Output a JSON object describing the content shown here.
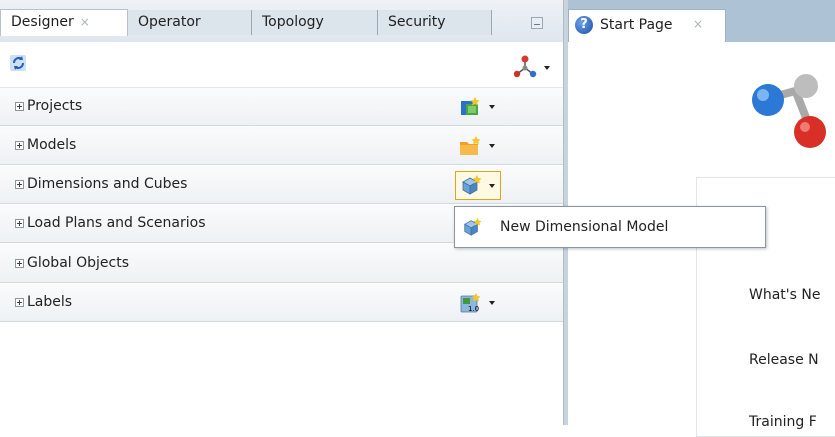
{
  "left_tabs": {
    "designer": "Designer",
    "operator": "Operator",
    "topology": "Topology",
    "security": "Security",
    "close_glyph": "×"
  },
  "navigator_rows": [
    {
      "label": "Projects",
      "icon": "new-project-icon"
    },
    {
      "label": "Models",
      "icon": "new-model-folder-icon"
    },
    {
      "label": "Dimensions and Cubes",
      "icon": "dimensional-model-icon"
    },
    {
      "label": "Load Plans and Scenarios",
      "icon": ""
    },
    {
      "label": "Global Objects",
      "icon": ""
    },
    {
      "label": "Labels",
      "icon": "new-label-icon"
    }
  ],
  "popup_menu": {
    "item_label": "New Dimensional Model",
    "icon": "dimensional-model-icon"
  },
  "right_tabs": {
    "start_page": "Start Page",
    "help_glyph": "?",
    "close_glyph": "×"
  },
  "start_page": {
    "links": [
      "What's Ne",
      "Release N",
      "Training F"
    ]
  },
  "colors": {
    "tabbar_bg": "#dce4ec",
    "right_tabbar_bg": "#aec2d5",
    "highlight_border": "#e0a419",
    "splitter": "#c8d3de"
  }
}
